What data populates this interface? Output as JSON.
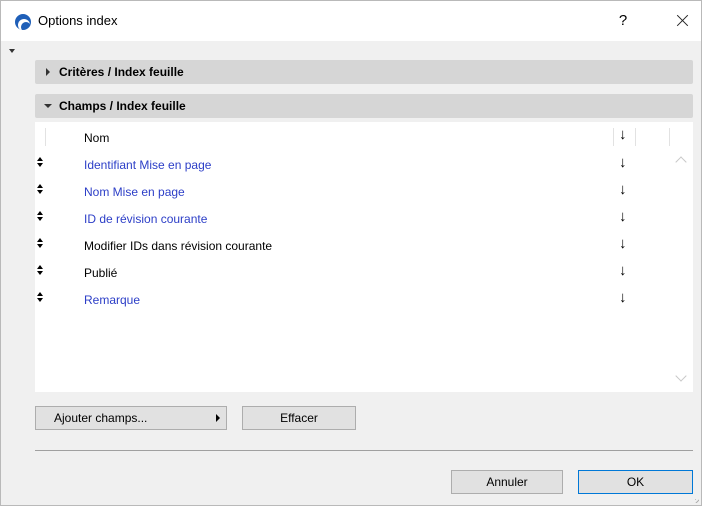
{
  "window": {
    "title": "Options index",
    "help_label": "?"
  },
  "sections": {
    "criteria": {
      "label": "Critères / Index feuille",
      "expanded": false
    },
    "fields": {
      "label": "Champs / Index feuille",
      "expanded": true
    }
  },
  "list": {
    "header": {
      "name": "Nom",
      "sort_symbol": "↓"
    },
    "rows": [
      {
        "label": "Identifiant Mise en page",
        "color": "#2c3ec7",
        "sort_symbol": "↓"
      },
      {
        "label": "Nom Mise en page",
        "color": "#2c3ec7",
        "sort_symbol": "↓"
      },
      {
        "label": "ID de révision courante",
        "color": "#2c3ec7",
        "sort_symbol": "↓"
      },
      {
        "label": "Modifier IDs dans révision courante",
        "color": "#000000",
        "sort_symbol": "↓"
      },
      {
        "label": "Publié",
        "color": "#000000",
        "sort_symbol": "↓"
      },
      {
        "label": "Remarque",
        "color": "#2c3ec7",
        "sort_symbol": "↓"
      }
    ]
  },
  "buttons": {
    "add_fields": "Ajouter champs...",
    "clear": "Effacer",
    "cancel": "Annuler",
    "ok": "OK"
  }
}
